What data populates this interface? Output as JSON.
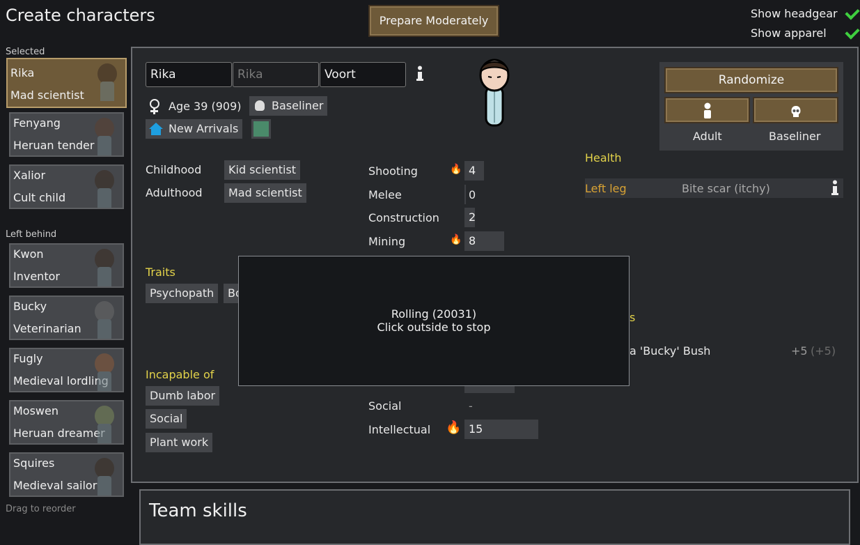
{
  "header": {
    "title": "Create characters",
    "prepare_button": "Prepare Moderately",
    "toggles": [
      {
        "label": "Show headgear",
        "checked": true
      },
      {
        "label": "Show apparel",
        "checked": true
      }
    ]
  },
  "sidebar": {
    "selected_label": "Selected",
    "selected": [
      {
        "name": "Rika",
        "job": "Mad scientist"
      },
      {
        "name": "Fenyang",
        "job": "Heruan tender"
      },
      {
        "name": "Xalior",
        "job": "Cult child"
      }
    ],
    "left_behind_label": "Left behind",
    "left_behind": [
      {
        "name": "Kwon",
        "job": "Inventor"
      },
      {
        "name": "Bucky",
        "job": "Veterinarian"
      },
      {
        "name": "Fugly",
        "job": "Medieval lordling"
      },
      {
        "name": "Moswen",
        "job": "Heruan dreamer"
      },
      {
        "name": "Squires",
        "job": "Medieval sailor"
      }
    ],
    "footer": "Drag to reorder"
  },
  "character": {
    "first_name": "Rika",
    "nick_placeholder": "Rika",
    "last_name": "Voort",
    "age": "Age 39 (909)",
    "xenotype": "Baseliner",
    "faction": "New Arrivals",
    "favorite_color": "#4a8a6a",
    "backstory": {
      "childhood_label": "Childhood",
      "childhood": "Kid scientist",
      "adulthood_label": "Adulthood",
      "adulthood": "Mad scientist"
    },
    "traits_label": "Traits",
    "traits": [
      "Psychopath",
      "Bo"
    ],
    "incapable_label": "Incapable of",
    "incapable": [
      "Dumb labor",
      "Social",
      "Plant work"
    ]
  },
  "skills": [
    {
      "name": "Shooting",
      "passion": "minor",
      "value": "4"
    },
    {
      "name": "Melee",
      "passion": "none",
      "value": "0"
    },
    {
      "name": "Construction",
      "passion": "none",
      "value": "2"
    },
    {
      "name": "Mining",
      "passion": "minor",
      "value": "8"
    },
    {
      "name": "Social",
      "passion": "none",
      "value": "-"
    },
    {
      "name": "Intellectual",
      "passion": "major",
      "value": "15"
    }
  ],
  "randomize": {
    "button": "Randomize",
    "dev_stage": "Adult",
    "xenotype": "Baseliner"
  },
  "health": {
    "label": "Health",
    "part": "Left leg",
    "condition": "Bite scar (itchy)"
  },
  "relations": {
    "label_fragment": "s",
    "person": "a 'Bucky' Bush",
    "opinion": "+5",
    "opinion_paren": "(+5)"
  },
  "overlay": {
    "line1": "Rolling (20031)",
    "line2": "Click outside to stop"
  },
  "team": {
    "title": "Team skills"
  },
  "colors": {
    "accent_brown": "#6e5a39",
    "gold": "#e3d34a",
    "health_orange": "#d9a334"
  }
}
